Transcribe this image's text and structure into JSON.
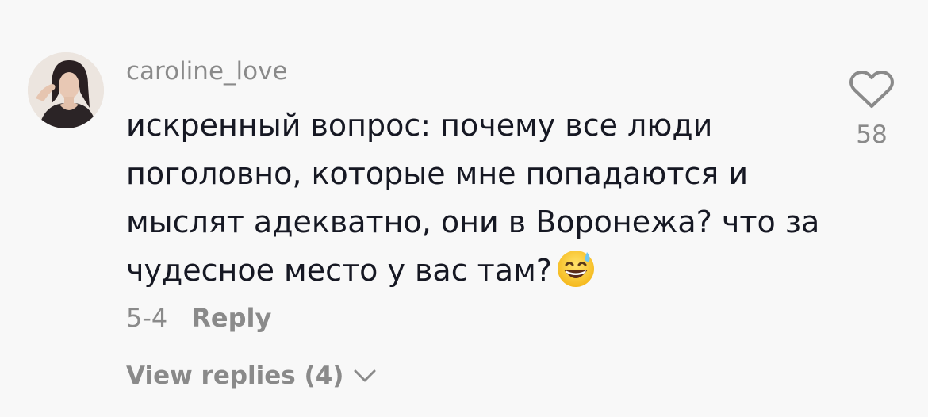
{
  "comment": {
    "username": "caroline_love",
    "text": "искренный вопрос: почему все люди поголовно, которые мне попадаются и мыслят адекватно, они в Воронежа? что за чудесное место у вас там?",
    "emoji": "grinning-face-with-sweat-emoji",
    "date": "5-4",
    "reply_label": "Reply",
    "view_replies_label": "View replies (4)",
    "like_count": "58"
  },
  "colors": {
    "background": "#f8f8f8",
    "text": "#161823",
    "muted": "#8a8a8a"
  },
  "icons": {
    "like": "heart-outline-icon",
    "expand": "chevron-down-icon"
  }
}
